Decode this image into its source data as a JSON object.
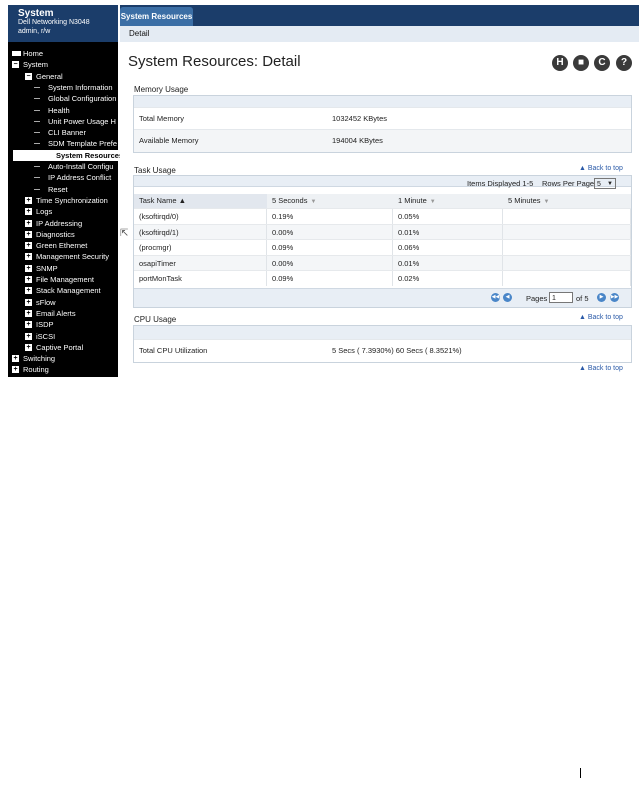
{
  "sidebar": {
    "title": "System",
    "device": "Dell Networking N3048",
    "user": "admin, r/w",
    "items": [
      {
        "label": "Home",
        "indent": 0,
        "type": "home"
      },
      {
        "label": "System",
        "indent": 0,
        "type": "minus"
      },
      {
        "label": "General",
        "indent": 1,
        "type": "minus"
      },
      {
        "label": "System Information",
        "indent": 2,
        "type": "leaf"
      },
      {
        "label": "Global Configuration",
        "indent": 2,
        "type": "leaf"
      },
      {
        "label": "Health",
        "indent": 2,
        "type": "leaf"
      },
      {
        "label": "Unit Power Usage H",
        "indent": 2,
        "type": "leaf"
      },
      {
        "label": "CLI Banner",
        "indent": 2,
        "type": "leaf"
      },
      {
        "label": "SDM Template Prefe",
        "indent": 2,
        "type": "leaf"
      },
      {
        "label": "System Resources",
        "indent": 2,
        "type": "leaf",
        "selected": true
      },
      {
        "label": "Auto-Install Configu",
        "indent": 2,
        "type": "leaf"
      },
      {
        "label": "IP Address Conflict",
        "indent": 2,
        "type": "leaf"
      },
      {
        "label": "Reset",
        "indent": 2,
        "type": "leaf"
      },
      {
        "label": "Time Synchronization",
        "indent": 1,
        "type": "plus"
      },
      {
        "label": "Logs",
        "indent": 1,
        "type": "plus"
      },
      {
        "label": "IP Addressing",
        "indent": 1,
        "type": "plus"
      },
      {
        "label": "Diagnostics",
        "indent": 1,
        "type": "plus"
      },
      {
        "label": "Green Ethernet",
        "indent": 1,
        "type": "plus"
      },
      {
        "label": "Management Security",
        "indent": 1,
        "type": "plus"
      },
      {
        "label": "SNMP",
        "indent": 1,
        "type": "plus"
      },
      {
        "label": "File Management",
        "indent": 1,
        "type": "plus"
      },
      {
        "label": "Stack Management",
        "indent": 1,
        "type": "plus"
      },
      {
        "label": "sFlow",
        "indent": 1,
        "type": "plus"
      },
      {
        "label": "Email Alerts",
        "indent": 1,
        "type": "plus"
      },
      {
        "label": "ISDP",
        "indent": 1,
        "type": "plus"
      },
      {
        "label": "iSCSI",
        "indent": 1,
        "type": "plus"
      },
      {
        "label": "Captive Portal",
        "indent": 1,
        "type": "plus"
      },
      {
        "label": "Switching",
        "indent": 0,
        "type": "plus"
      },
      {
        "label": "Routing",
        "indent": 0,
        "type": "plus"
      }
    ]
  },
  "header": {
    "tab": "System Resources",
    "subtab": "Detail",
    "title": "System Resources: Detail"
  },
  "toolbar": {
    "icons": [
      "save-icon",
      "print-icon",
      "refresh-icon",
      "help-icon"
    ],
    "glyphs": [
      "H",
      "■",
      "C",
      "?"
    ]
  },
  "memory": {
    "title": "Memory Usage",
    "rows": [
      {
        "label": "Total Memory",
        "value": "1032452  KBytes"
      },
      {
        "label": "Available Memory",
        "value": "194004  KBytes"
      }
    ]
  },
  "tasks": {
    "title": "Task Usage",
    "back_link": "▲ Back to top",
    "items_displayed": "Items Displayed 1-5",
    "rows_per_page_label": "Rows Per Page",
    "rows_per_page": "5",
    "columns": [
      "Task Name ▲",
      "5 Seconds",
      "1 Minute",
      "5 Minutes"
    ],
    "rows": [
      [
        "(ksoftirqd/0)",
        "0.19%",
        "0.05%",
        ""
      ],
      [
        "(ksoftirqd/1)",
        "0.00%",
        "0.01%",
        ""
      ],
      [
        "(procmgr)",
        "0.09%",
        "0.06%",
        ""
      ],
      [
        "osapiTimer",
        "0.00%",
        "0.01%",
        ""
      ],
      [
        "portMonTask",
        "0.09%",
        "0.02%",
        ""
      ]
    ],
    "pages_label": "Pages",
    "page": "1",
    "of_pages": "of 5"
  },
  "cpu": {
    "title": "CPU Usage",
    "back_link": "▲ Back to top",
    "label": "Total CPU Utilization",
    "value": "5 Secs ( 7.3930%) 60 Secs ( 8.3521%)"
  },
  "footer_back_link": "▲ Back to top"
}
